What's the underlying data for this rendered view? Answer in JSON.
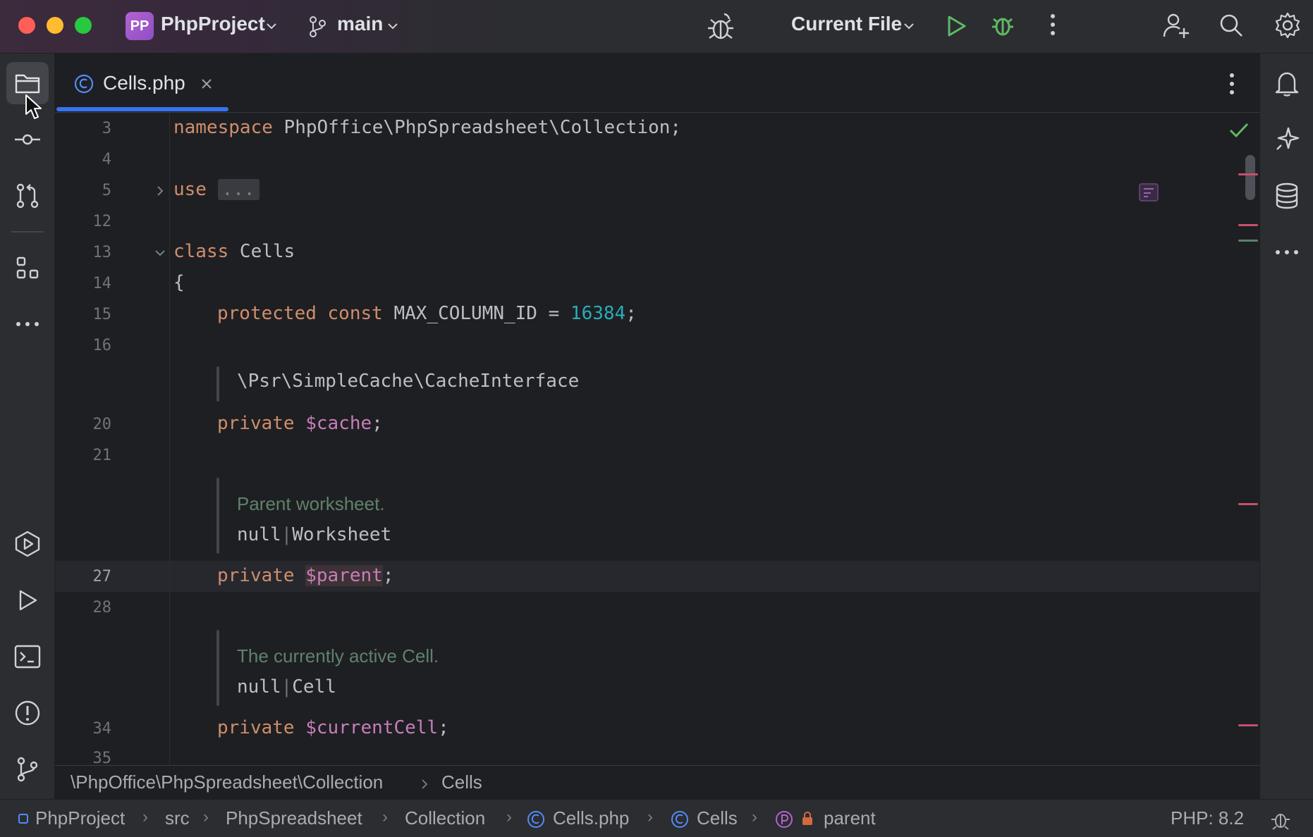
{
  "titlebar": {
    "project_badge": "PP",
    "project_name": "PhpProject",
    "branch": "main",
    "run_config": "Current File"
  },
  "tab": {
    "file_name": "Cells.php"
  },
  "editor": {
    "line_numbers": [
      "3",
      "4",
      "5",
      "12",
      "13",
      "14",
      "15",
      "16",
      "20",
      "21",
      "27",
      "28",
      "34",
      "35"
    ],
    "current_line": "27",
    "code": {
      "namespace_kw": "namespace",
      "namespace_path": " PhpOffice\\PhpSpreadsheet\\Collection;",
      "use_kw": "use",
      "use_folded": "...",
      "class_kw": "class",
      "class_name": " Cells",
      "open_brace": "{",
      "const_kw": "protected const",
      "const_name": " MAX_COLUMN_ID = ",
      "const_value": "16384",
      "semicolon": ";",
      "cache_type": "\\Psr\\SimpleCache\\CacheInterface",
      "private_kw": "private",
      "cache_var": "$cache",
      "parent_doc": "Parent worksheet.",
      "null_kw": "null",
      "pipe": "|",
      "worksheet_type": "Worksheet",
      "parent_var": "$parent",
      "cell_doc": "The currently active Cell.",
      "cell_type": "Cell",
      "currentcell_var": "$currentCell"
    }
  },
  "breadcrumb": {
    "namespace": "\\PhpOffice\\PhpSpreadsheet\\Collection",
    "class": "Cells"
  },
  "statusbar": {
    "path": [
      "PhpProject",
      "src",
      "PhpSpreadsheet",
      "Collection",
      "Cells.php",
      "Cells",
      "parent"
    ],
    "php_version": "PHP: 8.2"
  },
  "colors": {
    "accent": "#3574f0",
    "keyword": "#cf8e6d",
    "number": "#2aacb8",
    "variable": "#c77dbb",
    "doc_comment": "#5f826b"
  }
}
